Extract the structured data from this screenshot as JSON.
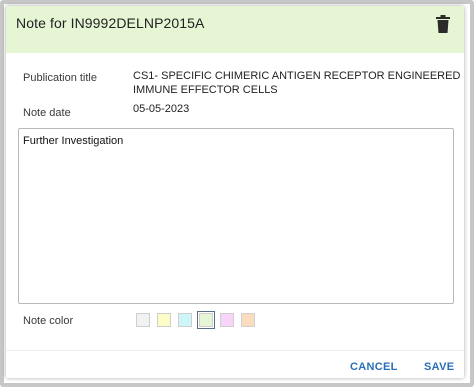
{
  "dialog": {
    "title": "Note for IN9992DELNP2015A",
    "header_color": "#e6f6d4"
  },
  "fields": {
    "publication_title_label": "Publication title",
    "publication_title_value_line1": "CS1- SPECIFIC CHIMERIC ANTIGEN RECEPTOR ENGINEERED",
    "publication_title_value_line2": "IMMUNE EFFECTOR CELLS",
    "note_date_label": "Note date",
    "note_date_value": "05-05-2023"
  },
  "note": {
    "text": "Further Investigation"
  },
  "note_color": {
    "label": "Note color",
    "options": [
      {
        "name": "grey",
        "hex": "#f2f2f2"
      },
      {
        "name": "yellow",
        "hex": "#fdfbc8"
      },
      {
        "name": "cyan",
        "hex": "#cdf6f8"
      },
      {
        "name": "green",
        "hex": "#e6f6d4"
      },
      {
        "name": "pink",
        "hex": "#f8d5f8"
      },
      {
        "name": "orange",
        "hex": "#fadcc0"
      }
    ],
    "selected": "green"
  },
  "actions": {
    "cancel_label": "CANCEL",
    "save_label": "SAVE"
  },
  "icons": {
    "delete": "trash-icon"
  }
}
